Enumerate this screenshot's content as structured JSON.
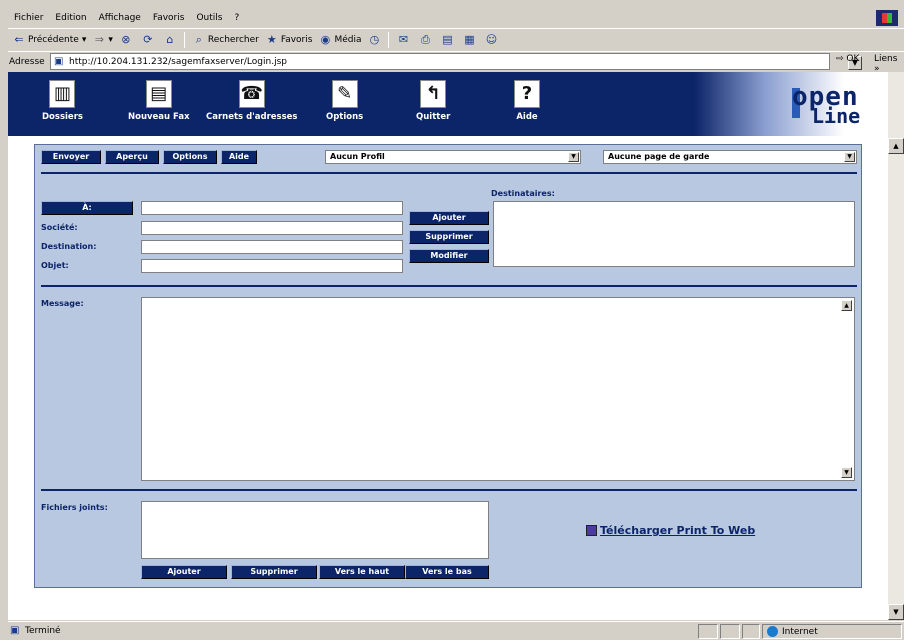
{
  "browser": {
    "menu": [
      {
        "label": "Fichier"
      },
      {
        "label": "Edition"
      },
      {
        "label": "Affichage"
      },
      {
        "label": "Favoris"
      },
      {
        "label": "Outils"
      },
      {
        "label": "?"
      }
    ],
    "toolbar": {
      "back_label": "Précédente",
      "search_label": "Rechercher",
      "favorites_label": "Favoris",
      "media_label": "Média"
    },
    "address_label": "Adresse",
    "address_value": "http://10.204.131.232/sagemfaxserver/Login.jsp",
    "go_label": "OK",
    "links_label": "Liens »",
    "status_text": "Terminé",
    "zone_text": "Internet"
  },
  "nav": {
    "items": [
      {
        "label": "Dossiers",
        "icon": "folder-icon"
      },
      {
        "label": "Nouveau Fax",
        "icon": "fax-icon"
      },
      {
        "label": "Carnets d'adresses",
        "icon": "phone-icon"
      },
      {
        "label": "Options",
        "icon": "wrench-icon"
      },
      {
        "label": "Quitter",
        "icon": "exit-icon"
      },
      {
        "label": "Aide",
        "icon": "help-icon"
      }
    ],
    "logo_line1": "open",
    "logo_line2": "Line"
  },
  "form": {
    "top_buttons": {
      "send": "Envoyer",
      "preview": "Aperçu",
      "options": "Options",
      "help": "Aide"
    },
    "profile_select": "Aucun Profil",
    "cover_select": "Aucune page de garde",
    "to_button": "À:",
    "labels": {
      "company": "Société:",
      "destination": "Destination:",
      "subject": "Objet:",
      "recipients": "Destinataires:",
      "message": "Message:",
      "attachments": "Fichiers joints:"
    },
    "recipient_buttons": {
      "add": "Ajouter",
      "remove": "Supprimer",
      "modify": "Modifier"
    },
    "attach_buttons": {
      "add": "Ajouter",
      "remove": "Supprimer",
      "up": "Vers le haut",
      "down": "Vers le bas"
    },
    "download_link": "Télécharger Print To Web"
  },
  "colors": {
    "navy": "#0c2468",
    "panel": "#b8c8e0"
  }
}
